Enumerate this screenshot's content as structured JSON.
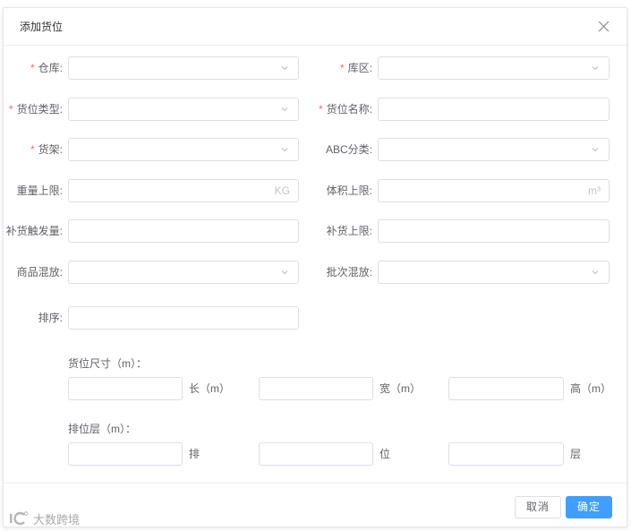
{
  "dialog": {
    "title": "添加货位",
    "close_icon": "close-icon"
  },
  "required_mark": "*",
  "rows": [
    {
      "left": {
        "label": "仓库:",
        "required": true,
        "icon": "chevron-down-icon"
      },
      "right": {
        "label": "库区:",
        "required": true,
        "icon": "chevron-down-icon"
      }
    },
    {
      "left": {
        "label": "货位类型:",
        "required": true,
        "icon": "chevron-down-icon"
      },
      "right": {
        "label": "货位名称:",
        "required": true
      }
    },
    {
      "left": {
        "label": "货架:",
        "required": true,
        "icon": "chevron-down-icon"
      },
      "right": {
        "label": "ABC分类:",
        "required": false,
        "icon": "chevron-down-icon"
      }
    },
    {
      "left": {
        "label": "重量上限:",
        "required": false,
        "suffix": "KG"
      },
      "right": {
        "label": "体积上限:",
        "required": false,
        "suffix": "m³"
      }
    },
    {
      "left": {
        "label": "补货触发量:",
        "required": false
      },
      "right": {
        "label": "补货上限:",
        "required": false
      }
    },
    {
      "left": {
        "label": "商品混放:",
        "required": false,
        "icon": "chevron-down-icon"
      },
      "right": {
        "label": "批次混放:",
        "required": false,
        "icon": "chevron-down-icon"
      }
    },
    {
      "left": {
        "label": "排序:",
        "required": false
      }
    }
  ],
  "size_section": {
    "label": "货位尺寸（m）：",
    "units": [
      "长（m）",
      "宽（m）",
      "高（m）"
    ]
  },
  "layer_section": {
    "label": "排位层（m）：",
    "units": [
      "排",
      "位",
      "层"
    ]
  },
  "footer": {
    "cancel_label": "取消",
    "confirm_label": "确定"
  },
  "watermark": {
    "text": "大数跨境",
    "logo_icon": "watermark-logo-icon"
  },
  "colors": {
    "primary": "#409eff",
    "required": "#f56c6c",
    "label": "#606266",
    "title": "#303133",
    "border": "#dcdfe6",
    "divider": "#ebeef5",
    "muted": "#c0c4cc"
  }
}
